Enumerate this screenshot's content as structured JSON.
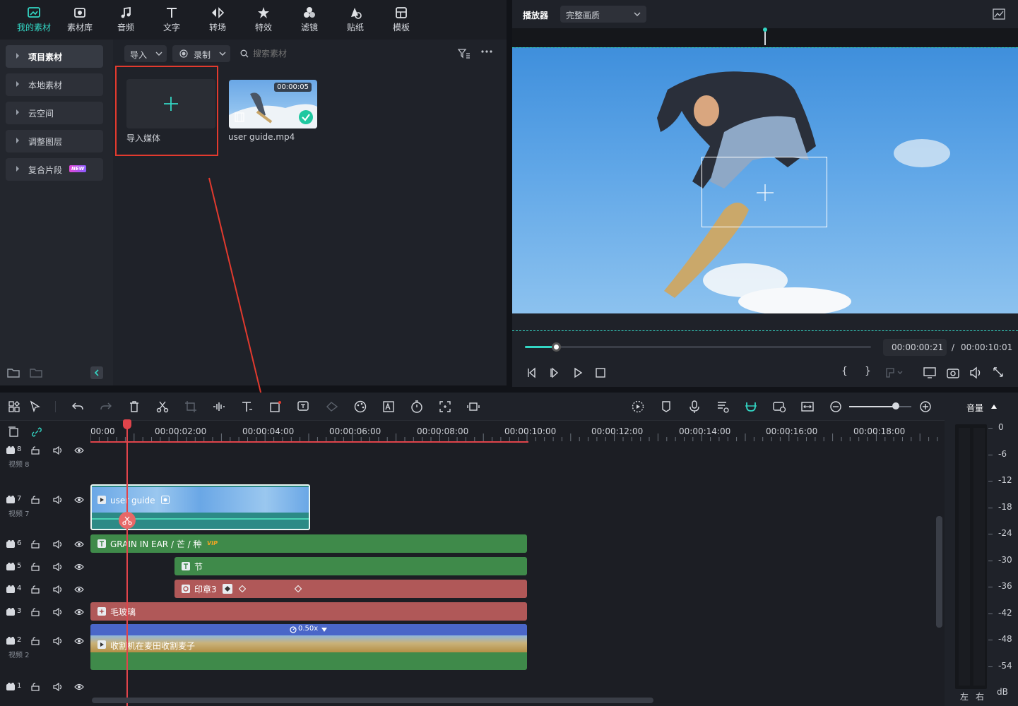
{
  "nav": {
    "items": [
      {
        "label": "我的素材",
        "icon": "my-media-icon"
      },
      {
        "label": "素材库",
        "icon": "library-icon"
      },
      {
        "label": "音频",
        "icon": "music-note-icon"
      },
      {
        "label": "文字",
        "icon": "text-t-icon"
      },
      {
        "label": "转场",
        "icon": "transition-icon"
      },
      {
        "label": "特效",
        "icon": "effects-icon"
      },
      {
        "label": "滤镜",
        "icon": "filter-icon"
      },
      {
        "label": "贴纸",
        "icon": "sticker-icon"
      },
      {
        "label": "模板",
        "icon": "template-icon"
      }
    ],
    "active": "我的素材"
  },
  "sidebar": {
    "items": [
      {
        "label": "项目素材"
      },
      {
        "label": "本地素材"
      },
      {
        "label": "云空间"
      },
      {
        "label": "调整图层"
      },
      {
        "label": "复合片段",
        "badge": "NEW"
      }
    ]
  },
  "media": {
    "import_label": "导入",
    "record_label": "录制",
    "search_placeholder": "搜索素材",
    "import_tile_label": "导入媒体",
    "clip": {
      "name": "user guide.mp4",
      "duration": "00:00:05"
    }
  },
  "player": {
    "title": "播放器",
    "quality": "完整画质",
    "current_time": "00:00:00:21",
    "separator": "/",
    "total_time": "00:00:10:01",
    "progress": 0.09,
    "mark_in": "{",
    "mark_out": "}"
  },
  "timeline": {
    "ruler": [
      "00:00",
      "00:00:02:00",
      "00:00:04:00",
      "00:00:06:00",
      "00:00:08:00",
      "00:00:10:00",
      "00:00:12:00",
      "00:00:14:00",
      "00:00:16:00",
      "00:00:18:00"
    ],
    "tracks": [
      {
        "num": "8",
        "name": "视频 8"
      },
      {
        "num": "7",
        "name": "视频 7"
      },
      {
        "num": "6",
        "name": ""
      },
      {
        "num": "5",
        "name": ""
      },
      {
        "num": "4",
        "name": ""
      },
      {
        "num": "3",
        "name": ""
      },
      {
        "num": "2",
        "name": "视频 2"
      },
      {
        "num": "1",
        "name": ""
      }
    ],
    "clips": {
      "user_guide": "user guide",
      "title_clip": "GRAIN IN EAR / 芒 / 种",
      "vip": "VIP",
      "jie": "节",
      "stamp": "印章3",
      "frosted": "毛玻璃",
      "speed": "0.50x",
      "wheat": "收割机在麦田收割麦子"
    },
    "zoom": 0.75
  },
  "audio_meter": {
    "label": "音量",
    "scale": [
      "0",
      "-6",
      "-12",
      "-18",
      "-24",
      "-30",
      "-36",
      "-42",
      "-48",
      "-54",
      "dB"
    ],
    "left": "左",
    "right": "右"
  }
}
